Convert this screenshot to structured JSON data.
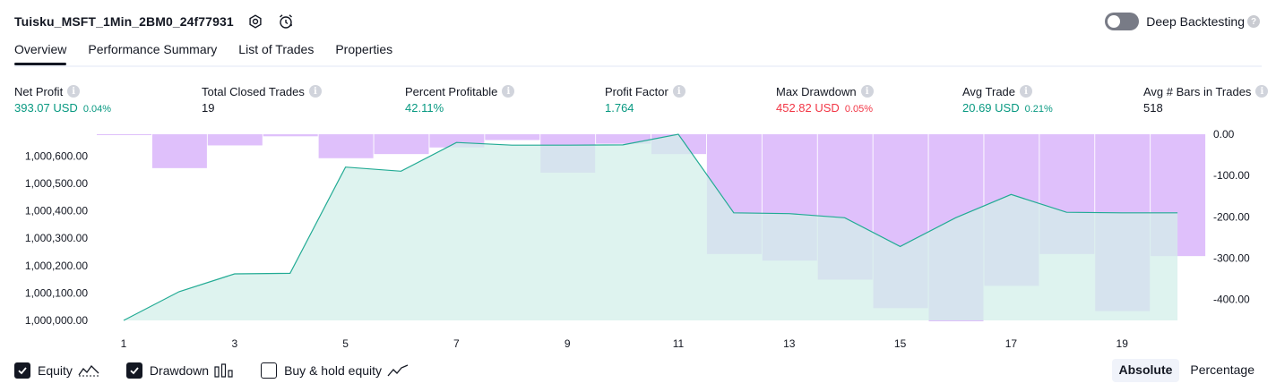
{
  "header": {
    "strategy_name": "Tuisku_MSFT_1Min_2BM0_24f77931",
    "deep_backtesting_label": "Deep Backtesting"
  },
  "tabs": [
    {
      "label": "Overview",
      "active": true
    },
    {
      "label": "Performance Summary",
      "active": false
    },
    {
      "label": "List of Trades",
      "active": false
    },
    {
      "label": "Properties",
      "active": false
    }
  ],
  "metrics": [
    {
      "label": "Net Profit",
      "value": "393.07 USD",
      "pct": "0.04%",
      "tone": "pos"
    },
    {
      "label": "Total Closed Trades",
      "value": "19",
      "pct": "",
      "tone": "neu"
    },
    {
      "label": "Percent Profitable",
      "value": "42.11%",
      "pct": "",
      "tone": "pos"
    },
    {
      "label": "Profit Factor",
      "value": "1.764",
      "pct": "",
      "tone": "pos"
    },
    {
      "label": "Max Drawdown",
      "value": "452.82 USD",
      "pct": "0.05%",
      "tone": "neg"
    },
    {
      "label": "Avg Trade",
      "value": "20.69 USD",
      "pct": "0.21%",
      "tone": "pos"
    },
    {
      "label": "Avg # Bars in Trades",
      "value": "518",
      "pct": "",
      "tone": "neu"
    }
  ],
  "legend": {
    "equity_label": "Equity",
    "drawdown_label": "Drawdown",
    "buyhold_label": "Buy & hold equity"
  },
  "modes": {
    "absolute_label": "Absolute",
    "percentage_label": "Percentage"
  },
  "colors": {
    "equity_line": "#22ab94",
    "equity_fill": "#d3efe9",
    "drawdown_bar": "#dfc0fb",
    "axis_text": "#131722",
    "positive": "#089981",
    "negative": "#f23645"
  },
  "chart_data": {
    "type": "line",
    "x": [
      1,
      2,
      3,
      4,
      5,
      6,
      7,
      8,
      9,
      10,
      11,
      12,
      13,
      14,
      15,
      16,
      17,
      18,
      19,
      20
    ],
    "x_tick_labels": [
      "1",
      "3",
      "5",
      "7",
      "9",
      "11",
      "13",
      "15",
      "17",
      "19"
    ],
    "series": [
      {
        "name": "Equity",
        "axis": "left",
        "type": "area",
        "values": [
          1000000.0,
          1000105.0,
          1000170.0,
          1000172.0,
          1000560.0,
          1000545.0,
          1000650.0,
          1000640.0,
          1000640.0,
          1000641.0,
          1000680.0,
          1000393.0,
          1000390.0,
          1000375.0,
          1000270.0,
          1000375.0,
          1000460.0,
          1000395.0,
          1000393.0,
          1000393.07
        ]
      },
      {
        "name": "Drawdown",
        "axis": "right",
        "type": "bar",
        "values": [
          -0.5,
          -82,
          -27,
          -5,
          -58,
          -48,
          -32,
          -14,
          -93,
          -23,
          -48,
          -290,
          -306,
          -352,
          -421,
          -452.82,
          -367,
          -290,
          -428,
          -295
        ]
      }
    ],
    "left_axis": {
      "ticks": [
        1000000,
        1000100,
        1000200,
        1000300,
        1000400,
        1000500,
        1000600
      ],
      "tick_labels": [
        "1,000,000.00",
        "1,000,100.00",
        "1,000,200.00",
        "1,000,300.00",
        "1,000,400.00",
        "1,000,500.00",
        "1,000,600.00"
      ],
      "range": [
        1000000,
        1000680
      ]
    },
    "right_axis": {
      "ticks": [
        0,
        -100,
        -200,
        -300,
        -400
      ],
      "tick_labels": [
        "0.00",
        "-100.00",
        "-200.00",
        "-300.00",
        "-400.00"
      ],
      "range": [
        -455,
        0
      ]
    },
    "grid": false
  }
}
